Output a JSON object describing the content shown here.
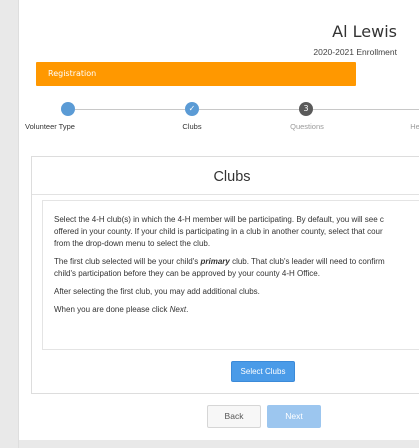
{
  "header": {
    "student_name": "Al Lewis",
    "enrollment": "2020-2021 Enrollment"
  },
  "registration_bar": {
    "label": "Registration",
    "color": "#ff9800"
  },
  "stepper": {
    "steps": [
      {
        "label": "Volunteer Type",
        "state": "done"
      },
      {
        "label": "Clubs",
        "state": "done"
      },
      {
        "label": "Questions",
        "state": "current",
        "number": "3"
      },
      {
        "label": "He",
        "state": "upcoming"
      }
    ],
    "done_color": "#5b9bd5",
    "current_color": "#5a5a5a"
  },
  "card": {
    "title": "Clubs",
    "paragraph1": [
      "Select the 4-H club(s) in which the 4-H member will be participating. By default, you will see c",
      "offered in your county. If your child is participating in a club in another county, select that cour",
      "from the drop-down menu to select the club."
    ],
    "paragraph2": {
      "line1_before": "The first club selected will be your child's ",
      "line1_emph": "primary",
      "line1_after": " club. That club's leader will need to confirm",
      "line2": "child's participation before they can be approved by your county 4-H Office."
    },
    "paragraph3": "After selecting the first club, you may add additional clubs.",
    "paragraph4": {
      "before": "When you are done please click ",
      "emph": "Next",
      "after": "."
    },
    "select_button": "Select Clubs"
  },
  "footer": {
    "back_label": "Back",
    "next_label": "Next"
  },
  "colors": {
    "primary_button": "#4a9be8",
    "disabled_button": "#9cc6ef"
  }
}
